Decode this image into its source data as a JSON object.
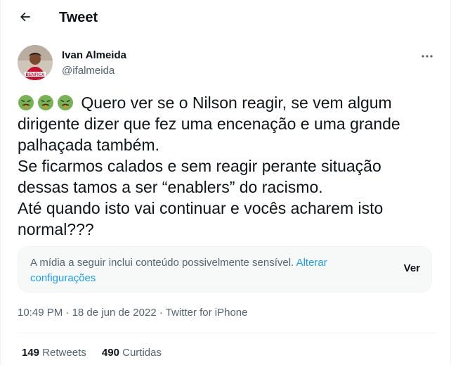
{
  "header": {
    "title": "Tweet"
  },
  "author": {
    "name": "Ivan Almeida",
    "handle": "@ifalmeida",
    "avatar_badge": "BENFICA"
  },
  "tweet": {
    "emojis": [
      "nauseated-face",
      "nauseated-face",
      "nauseated-face"
    ],
    "line1_rest": "Quero ver se o Nilson reagir, se vem algum",
    "line2": "dirigente dizer que fez uma encenação e uma grande",
    "line3": "palhaçada também.",
    "line4": "Se ficarmos calados e sem reagir perante situação",
    "line5": "dessas tamos a ser “enablers” do racismo.",
    "line6": "Até quando isto vai continuar e vocês acharem isto",
    "line7": "normal???"
  },
  "sensitive": {
    "notice": "A mídia a seguir inclui conteúdo possivelmente sensível.",
    "link_part1": "Alterar",
    "link_part2": "configurações",
    "view_label": "Ver"
  },
  "meta": {
    "time": "10:49 PM",
    "separator": "·",
    "date": "18 de jun de 2022",
    "source": "Twitter for iPhone"
  },
  "stats": {
    "retweets_count": "149",
    "retweets_label": "Retweets",
    "likes_count": "490",
    "likes_label": "Curtidas"
  },
  "colors": {
    "accent": "#1d9bf0",
    "secondary_text": "#536471",
    "primary_text": "#0f1419",
    "emoji_green": "#77b255"
  }
}
